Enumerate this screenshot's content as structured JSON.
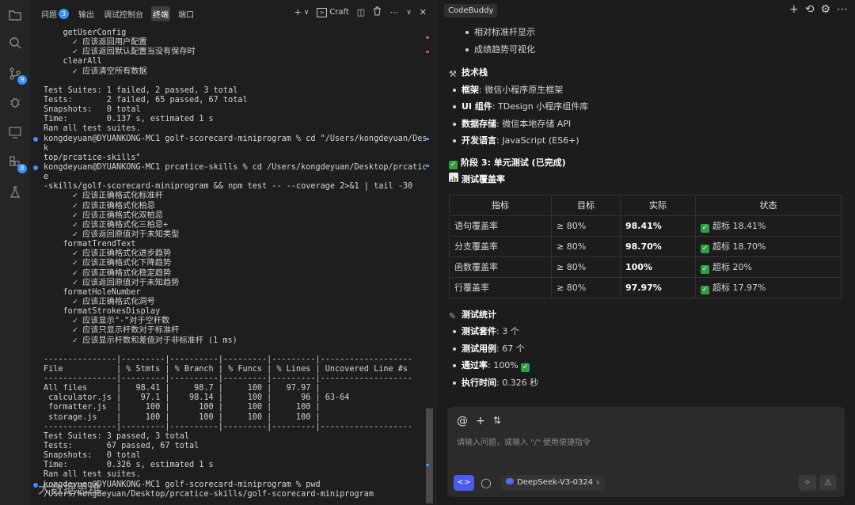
{
  "activity_bar": {
    "source_control_badge": "9",
    "extensions_badge": "8"
  },
  "terminal_tabs": [
    {
      "label": "问题",
      "badge": "3"
    },
    {
      "label": "输出"
    },
    {
      "label": "调试控制台"
    },
    {
      "label": "终端",
      "active": true
    },
    {
      "label": "端口"
    }
  ],
  "terminal_actions": {
    "add": "+",
    "dropdown": "∨",
    "shell_label": "Craft",
    "split": "◫",
    "trash": "🗑",
    "more": "⋯",
    "chevron": "∨",
    "close": "✕"
  },
  "terminal_lines": [
    {
      "text": "    getUserConfig"
    },
    {
      "text": "      ✓ 应该返回用户配置"
    },
    {
      "text": "      ✓ 应该返回默认配置当没有保存时"
    },
    {
      "text": "    clearAll"
    },
    {
      "text": "      ✓ 应该清空所有数据"
    },
    {
      "text": ""
    },
    {
      "text": "Test Suites: 1 failed, 2 passed, 3 total"
    },
    {
      "text": "Tests:       2 failed, 65 passed, 67 total"
    },
    {
      "text": "Snapshots:   0 total"
    },
    {
      "text": "Time:        0.137 s, estimated 1 s"
    },
    {
      "text": "Ran all test suites."
    },
    {
      "text": "kongdeyuan@DYUANKONG-MC1 golf-scorecard-miniprogram % cd \"/Users/kongdeyuan/Desk",
      "dot": true
    },
    {
      "text": "k"
    },
    {
      "text": "top/prcatice-skills\""
    },
    {
      "text": "kongdeyuan@DYUANKONG-MC1 prcatice-skills % cd /Users/kongdeyuan/Desktop/prcatic",
      "dot": true
    },
    {
      "text": "e"
    },
    {
      "text": "-skills/golf-scorecard-miniprogram && npm test -- --coverage 2>&1 | tail -30"
    },
    {
      "text": "      ✓ 应该正确格式化标准杆"
    },
    {
      "text": "      ✓ 应该正确格式化柏忌"
    },
    {
      "text": "      ✓ 应该正确格式化双柏忌"
    },
    {
      "text": "      ✓ 应该正确格式化三柏忌+"
    },
    {
      "text": "      ✓ 应该返回原值对于未知类型"
    },
    {
      "text": "    formatTrendText"
    },
    {
      "text": "      ✓ 应该正确格式化进步趋势"
    },
    {
      "text": "      ✓ 应该正确格式化下降趋势"
    },
    {
      "text": "      ✓ 应该正确格式化稳定趋势"
    },
    {
      "text": "      ✓ 应该返回原值对于未知趋势"
    },
    {
      "text": "    formatHoleNumber"
    },
    {
      "text": "      ✓ 应该正确格式化洞号"
    },
    {
      "text": "    formatStrokesDisplay"
    },
    {
      "text": "      ✓ 应该显示\"-\"对于空杆数"
    },
    {
      "text": "      ✓ 应该只显示杆数对于标准杆"
    },
    {
      "text": "      ✓ 应该显示杆数和差值对于非标准杆 (1 ms)"
    },
    {
      "text": ""
    },
    {
      "text": "---------------|---------|----------|---------|---------|-------------------"
    },
    {
      "text": "File           | % Stmts | % Branch | % Funcs | % Lines | Uncovered Line #s"
    },
    {
      "text": "---------------|---------|----------|---------|---------|-------------------"
    },
    {
      "text": "All files      |   98.41 |     98.7 |     100 |   97.97 |"
    },
    {
      "text": " calculator.js |    97.1 |    98.14 |     100 |      96 | 63-64"
    },
    {
      "text": " formatter.js  |     100 |      100 |     100 |     100 |"
    },
    {
      "text": " storage.js    |     100 |      100 |     100 |     100 |"
    },
    {
      "text": "---------------|---------|----------|---------|---------|-------------------"
    },
    {
      "text": "Test Suites: 3 passed, 3 total"
    },
    {
      "text": "Tests:       67 passed, 67 total"
    },
    {
      "text": "Snapshots:   0 total"
    },
    {
      "text": "Time:        0.326 s, estimated 1 s"
    },
    {
      "text": "Ran all test suites."
    },
    {
      "text": "kongdeyuan@DYUANKONG-MC1 golf-scorecard-miniprogram % pwd",
      "dot": true
    },
    {
      "text": "/Users/kongdeyuan/Desktop/prcatice-skills/golf-scorecard-miniprogram"
    }
  ],
  "watermark": "大数据思维",
  "panel": {
    "title": "CodeBuddy",
    "actions": {
      "add": "+",
      "history": "⟲",
      "settings": "⚙",
      "more": "⋯"
    },
    "intro_bullets": [
      "相对标准杆显示",
      "成绩趋势可视化"
    ],
    "tech_stack": {
      "heading": "技术栈",
      "items": [
        {
          "label": "框架",
          "value": "微信小程序原生框架"
        },
        {
          "label": "UI 组件",
          "value": "TDesign 小程序组件库"
        },
        {
          "label": "数据存储",
          "value": "微信本地存储 API"
        },
        {
          "label": "开发语言",
          "value": "JavaScript (ES6+)"
        }
      ]
    },
    "stage_heading": "阶段 3: 单元测试 (已完成)",
    "coverage_heading": "测试覆盖率",
    "coverage_table": {
      "headers": [
        "指标",
        "目标",
        "实际",
        "状态"
      ],
      "rows": [
        {
          "metric": "语句覆盖率",
          "target": "≥ 80%",
          "actual": "98.41%",
          "status": "超标 18.41%"
        },
        {
          "metric": "分支覆盖率",
          "target": "≥ 80%",
          "actual": "98.70%",
          "status": "超标 18.70%"
        },
        {
          "metric": "函数覆盖率",
          "target": "≥ 80%",
          "actual": "100%",
          "status": "超标 20%"
        },
        {
          "metric": "行覆盖率",
          "target": "≥ 80%",
          "actual": "97.97%",
          "status": "超标 17.97%"
        }
      ]
    },
    "stats_heading": "测试统计",
    "stats": [
      {
        "label": "测试套件",
        "value": "3 个"
      },
      {
        "label": "测试用例",
        "value": "67 个"
      },
      {
        "label": "通过率",
        "value": "100%"
      },
      {
        "label": "执行时间",
        "value": "0.326 秒"
      }
    ],
    "input": {
      "placeholder": "请输入问题，或输入 \"/\" 使用便捷指令",
      "icon_at": "@",
      "icon_plus": "+",
      "icon_tool": "⇅",
      "mode_label": "<>",
      "chat_label": "◯",
      "model": "DeepSeek-V3-0324",
      "model_caret": "∨",
      "sparkle": "✧",
      "warn": "⚠"
    }
  },
  "colors": {
    "accent": "#3794ff",
    "mode_button": "#4b5af0",
    "check_green": "#2ea043"
  }
}
